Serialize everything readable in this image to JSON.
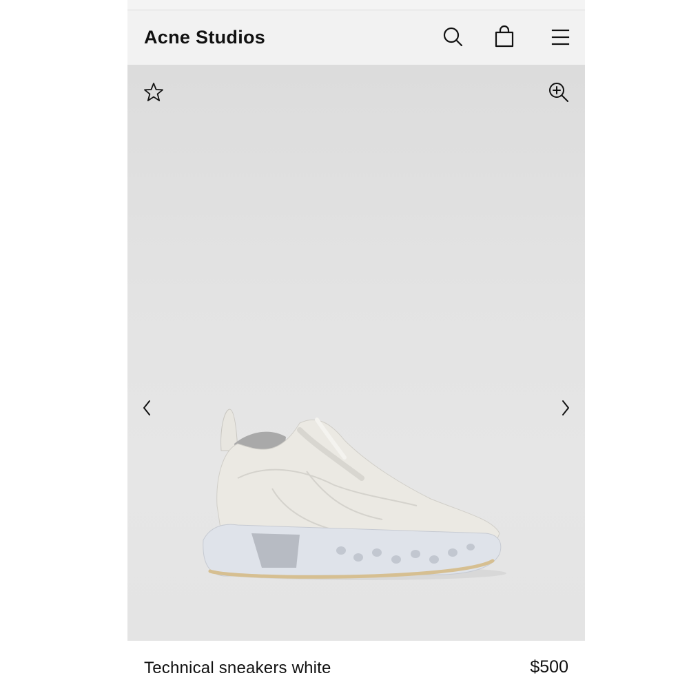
{
  "header": {
    "brand": "Acne Studios",
    "icons": {
      "search": "search-icon",
      "bag": "shopping-bag-icon",
      "menu": "hamburger-menu-icon"
    }
  },
  "gallery": {
    "icons": {
      "favorite": "star-icon",
      "zoom": "zoom-in-icon",
      "previous": "chevron-left-icon",
      "next": "chevron-right-icon"
    }
  },
  "product": {
    "name": "Technical sneakers white",
    "price": "$500"
  },
  "colors": {
    "header_bg": "#f2f2f2",
    "gallery_bg": "#e2e2e2",
    "text": "#111111"
  }
}
